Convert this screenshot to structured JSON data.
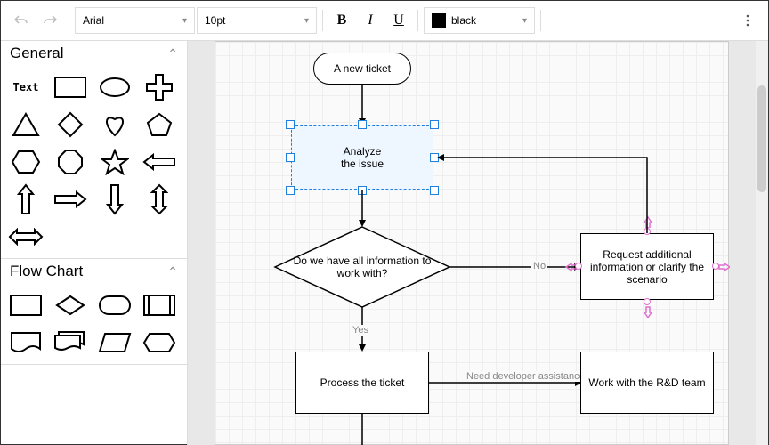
{
  "toolbar": {
    "font": "Arial",
    "size": "10pt",
    "bold": "B",
    "italic": "I",
    "underline": "U",
    "color_label": "black"
  },
  "sidebar": {
    "sections": [
      {
        "title": "General"
      },
      {
        "title": "Flow Chart"
      }
    ],
    "text_shape_label": "Text"
  },
  "flow": {
    "start": "A new ticket",
    "analyze": "Analyze\nthe issue",
    "decision": "Do we have all information to work with?",
    "request": "Request additional information or clarify the scenario",
    "process": "Process the ticket",
    "rnd": "Work with the R&D team",
    "yes": "Yes",
    "no": "No",
    "dev_assist": "Need developer assistance?"
  }
}
